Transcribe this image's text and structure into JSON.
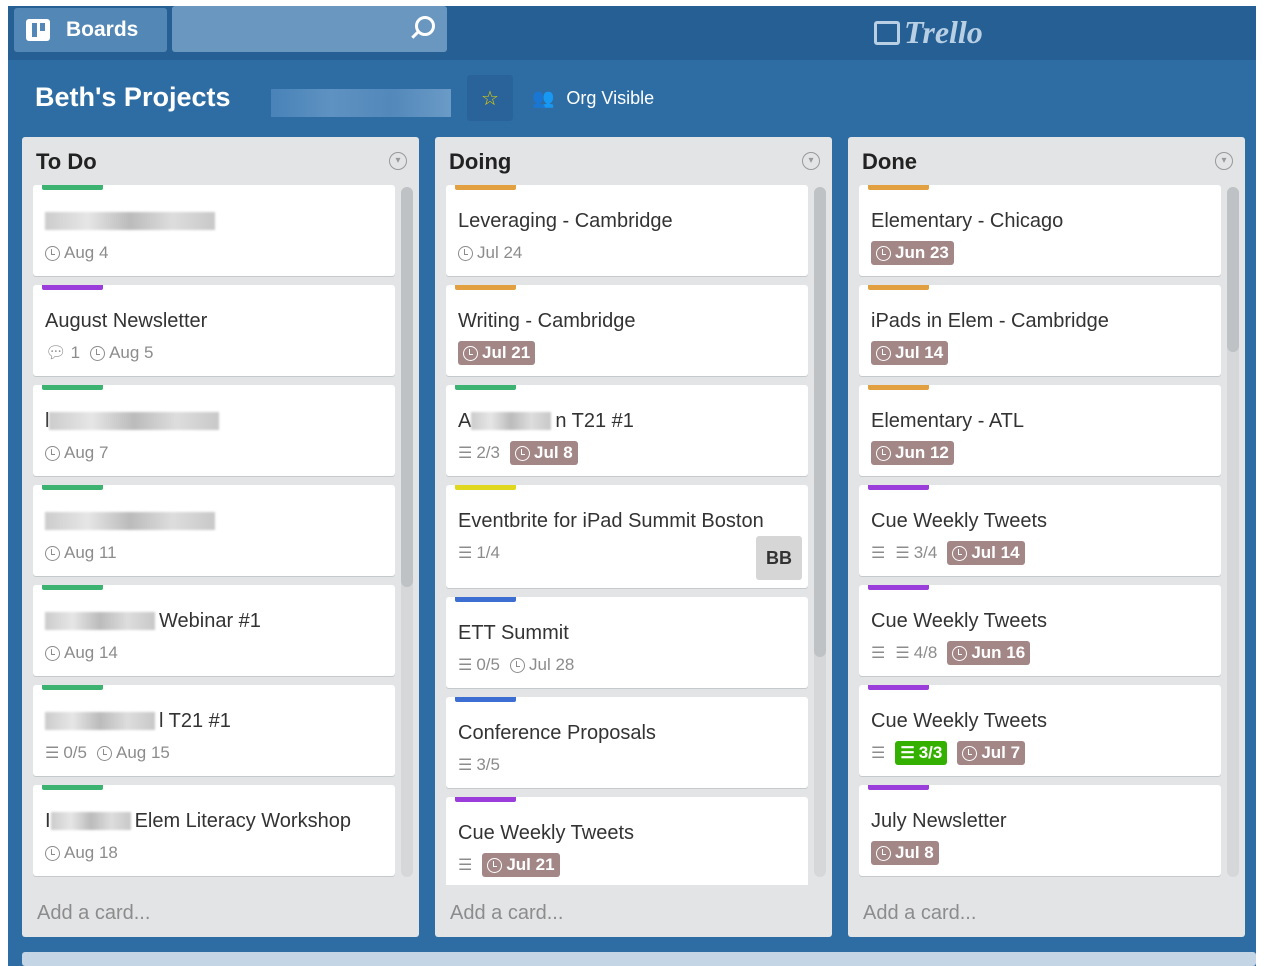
{
  "header": {
    "boards_label": "Boards",
    "logo_text": "Trello",
    "search_placeholder": ""
  },
  "board": {
    "title": "Beth's Projects",
    "visibility": "Org Visible",
    "starred": true
  },
  "colors": {
    "green": "#3cb371",
    "orange": "#e3a041",
    "purple": "#9a3ddb",
    "yellow": "#e0d81e",
    "blue": "#3c6fd1",
    "due_badge": "#a38686",
    "complete": "#34b100"
  },
  "add_card_label": "Add a card...",
  "lists": [
    {
      "title": "To Do",
      "cards": [
        {
          "label": "green",
          "redacted_prefix": true,
          "title": "",
          "due": "Aug 4",
          "due_style": "plain"
        },
        {
          "label": "purple",
          "title": "August Newsletter",
          "comments": "1",
          "due": "Aug 5",
          "due_style": "plain"
        },
        {
          "label": "green",
          "title_start": "l",
          "redacted_prefix": true,
          "title": "",
          "due": "Aug 7",
          "due_style": "plain"
        },
        {
          "label": "green",
          "redacted_prefix": true,
          "title": "",
          "due": "Aug 11",
          "due_style": "plain"
        },
        {
          "label": "green",
          "redacted_prefix": true,
          "title": "Webinar #1",
          "due": "Aug 14",
          "due_style": "plain"
        },
        {
          "label": "green",
          "redacted_prefix": true,
          "title": "l T21 #1",
          "checklist": "0/5",
          "due": "Aug 15",
          "due_style": "plain"
        },
        {
          "label": "green",
          "title_start": "I",
          "redacted_prefix": true,
          "title": "Elem Literacy Workshop",
          "due": "Aug 18",
          "due_style": "plain"
        }
      ]
    },
    {
      "title": "Doing",
      "cards": [
        {
          "label": "orange",
          "title": "Leveraging - Cambridge",
          "due": "Jul 24",
          "due_style": "plain"
        },
        {
          "label": "orange",
          "title": "Writing - Cambridge",
          "due": "Jul 21",
          "due_style": "overdue"
        },
        {
          "label": "green",
          "title_start": "A",
          "redacted_prefix": true,
          "title": "n T21 #1",
          "checklist": "2/3",
          "due": "Jul 8",
          "due_style": "overdue"
        },
        {
          "label": "yellow",
          "title": "Eventbrite for iPad Summit Boston",
          "checklist": "1/4",
          "member": "BB"
        },
        {
          "label": "blue",
          "title": "ETT Summit",
          "checklist": "0/5",
          "due": "Jul 28",
          "due_style": "plain"
        },
        {
          "label": "blue",
          "title": "Conference Proposals",
          "checklist": "3/5"
        },
        {
          "label": "purple",
          "title": "Cue Weekly Tweets",
          "description": true,
          "due": "Jul 21",
          "due_style": "overdue"
        }
      ]
    },
    {
      "title": "Done",
      "cards": [
        {
          "label": "orange",
          "title": "Elementary - Chicago",
          "due": "Jun 23",
          "due_style": "overdue"
        },
        {
          "label": "orange",
          "title": "iPads in Elem - Cambridge",
          "due": "Jul 14",
          "due_style": "overdue"
        },
        {
          "label": "orange",
          "title": "Elementary - ATL",
          "due": "Jun 12",
          "due_style": "overdue"
        },
        {
          "label": "purple",
          "title": "Cue Weekly Tweets",
          "description": true,
          "checklist": "3/4",
          "due": "Jul 14",
          "due_style": "overdue"
        },
        {
          "label": "purple",
          "title": "Cue Weekly Tweets",
          "description": true,
          "checklist": "4/8",
          "due": "Jun 16",
          "due_style": "overdue"
        },
        {
          "label": "purple",
          "title": "Cue Weekly Tweets",
          "description": true,
          "checklist": "3/3",
          "checklist_complete": true,
          "due": "Jul 7",
          "due_style": "overdue"
        },
        {
          "label": "purple",
          "title": "July Newsletter",
          "due": "Jul 8",
          "due_style": "overdue"
        }
      ]
    }
  ]
}
